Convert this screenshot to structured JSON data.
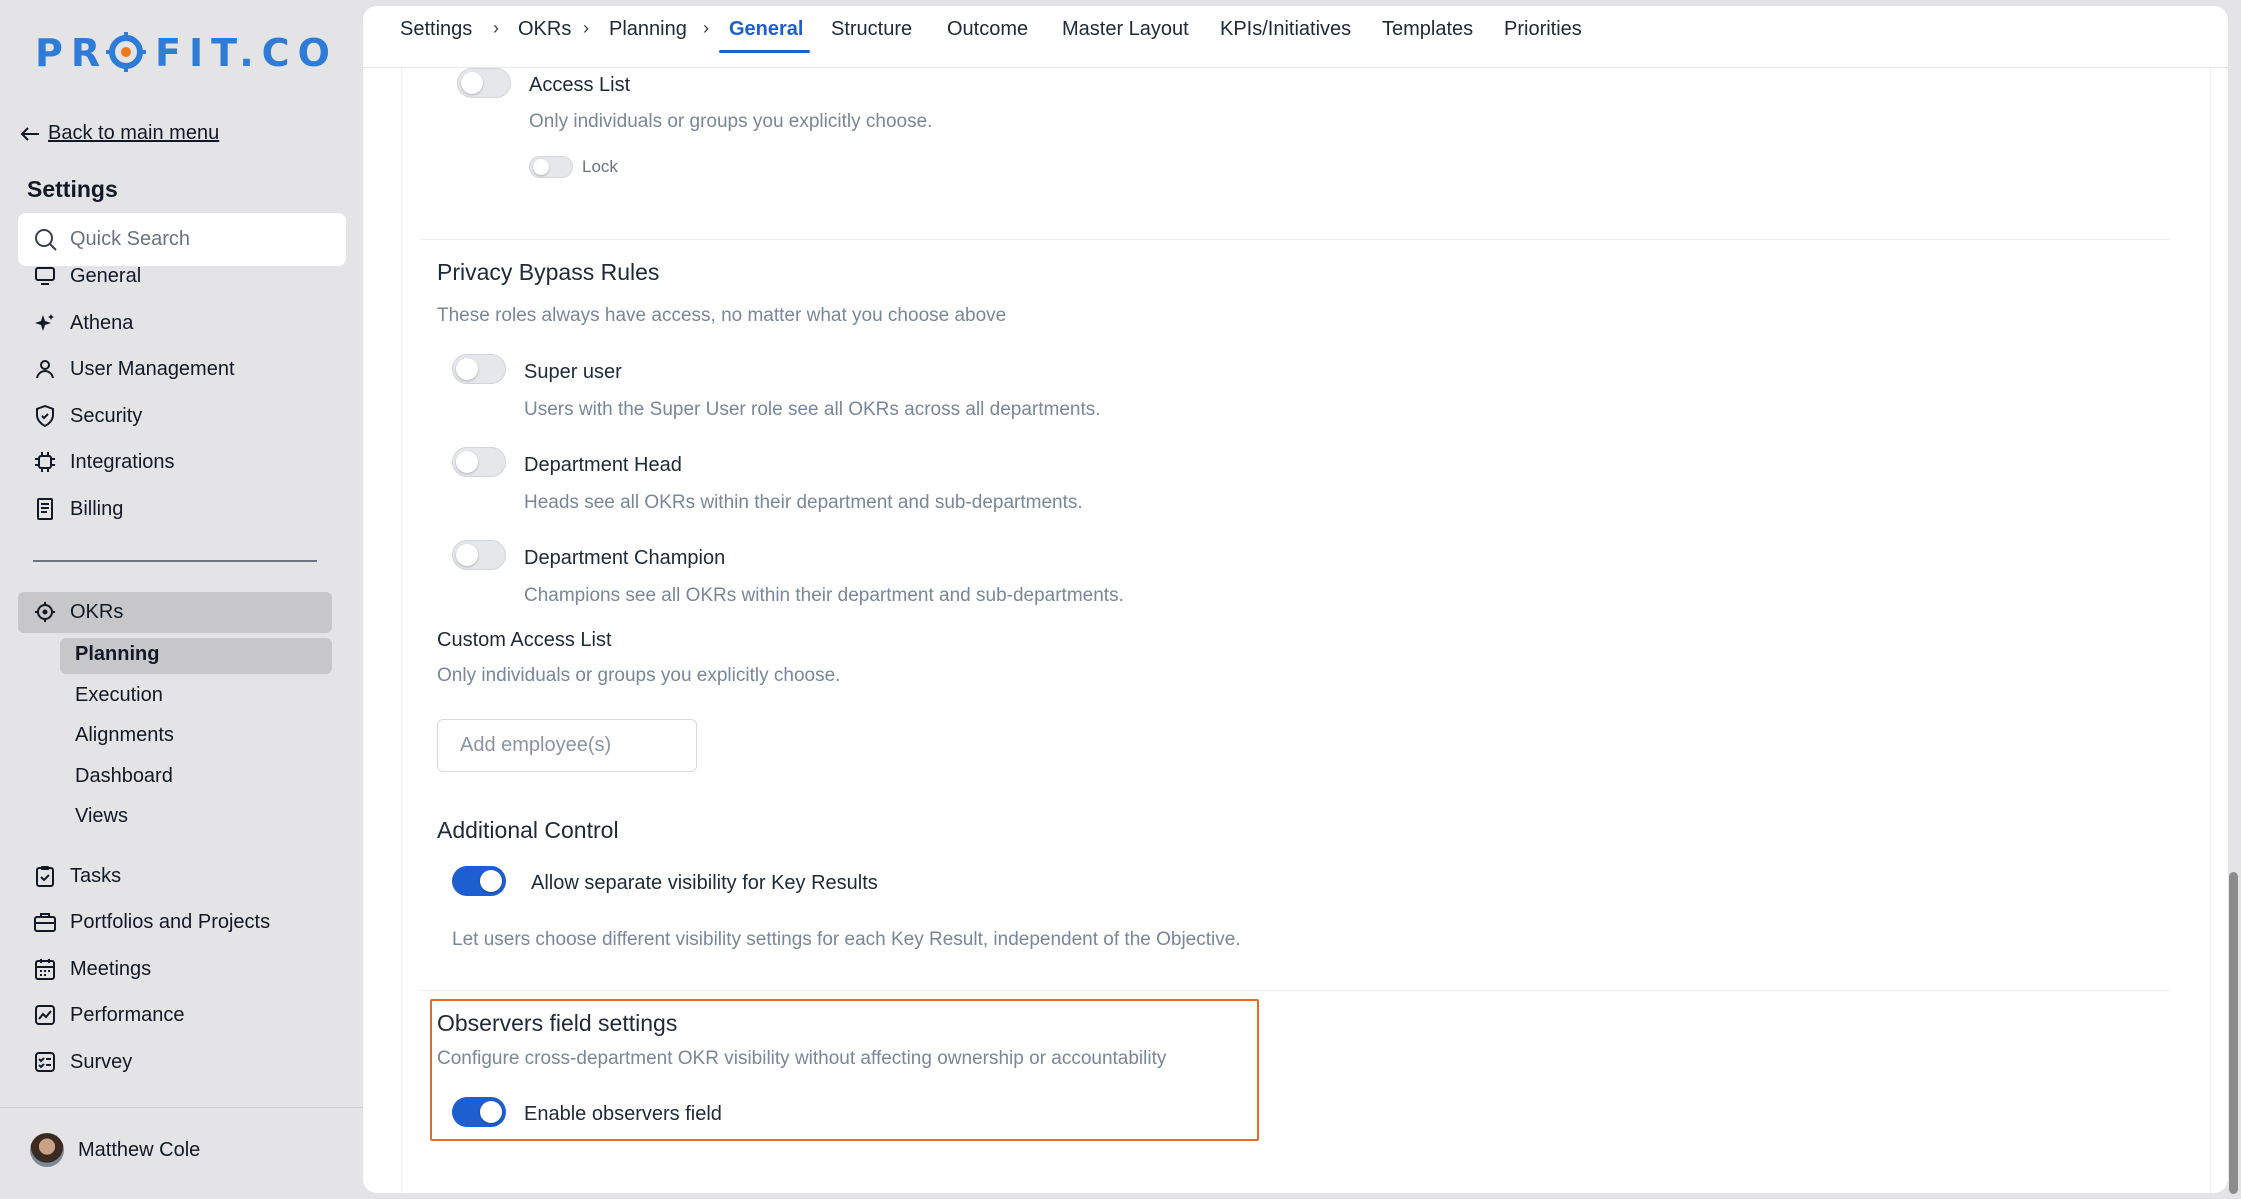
{
  "brand": {
    "logo_text": "PROFIT.CO",
    "accent": "#2e7bd8",
    "logo_dot": "#f07a1a"
  },
  "sidebar": {
    "back_link": "Back to main menu",
    "title": "Settings",
    "search_placeholder": "Quick Search",
    "items": [
      {
        "label": "General",
        "icon": "monitor-icon"
      },
      {
        "label": "Athena",
        "icon": "sparkle-icon"
      },
      {
        "label": "User Management",
        "icon": "user-icon"
      },
      {
        "label": "Security",
        "icon": "shield-icon"
      },
      {
        "label": "Integrations",
        "icon": "chip-icon"
      },
      {
        "label": "Billing",
        "icon": "receipt-icon"
      }
    ],
    "okrs": {
      "label": "OKRs",
      "icon": "target-icon",
      "children": [
        "Planning",
        "Execution",
        "Alignments",
        "Dashboard",
        "Views"
      ],
      "active_child": "Planning"
    },
    "more_items": [
      {
        "label": "Tasks",
        "icon": "clipboard-check-icon"
      },
      {
        "label": "Portfolios and Projects",
        "icon": "briefcase-icon"
      },
      {
        "label": "Meetings",
        "icon": "calendar-icon"
      },
      {
        "label": "Performance",
        "icon": "chart-line-icon"
      },
      {
        "label": "Survey",
        "icon": "checklist-icon"
      }
    ],
    "user": {
      "name": "Matthew Cole"
    }
  },
  "topnav": {
    "breadcrumb": [
      "Settings",
      "OKRs",
      "Planning"
    ],
    "separator": "›",
    "tabs": [
      "General",
      "Structure",
      "Outcome",
      "Master Layout",
      "KPIs/Initiatives",
      "Templates",
      "Priorities"
    ],
    "active_tab": "General"
  },
  "access_list": {
    "label": "Access List",
    "description": "Only individuals or groups you explicitly choose.",
    "lock_label": "Lock",
    "enabled": false,
    "lock_enabled": false
  },
  "privacy_bypass": {
    "title": "Privacy Bypass Rules",
    "description": "These roles always have access, no matter what you choose above",
    "rules": [
      {
        "label": "Super user",
        "description": "Users with the Super User role see all OKRs across all departments.",
        "enabled": false
      },
      {
        "label": "Department Head",
        "description": "Heads see all OKRs within their department and sub-departments.",
        "enabled": false
      },
      {
        "label": "Department Champion",
        "description": "Champions see all OKRs within their department and sub-departments.",
        "enabled": false
      }
    ]
  },
  "custom_access": {
    "title": "Custom Access List",
    "description": "Only individuals or groups you explicitly choose.",
    "input_placeholder": "Add employee(s)",
    "input_value": ""
  },
  "additional_control": {
    "title": "Additional Control",
    "toggle_label": "Allow separate visibility for Key Results",
    "enabled": true,
    "description": "Let users choose different visibility settings for each Key Result, independent of the Objective."
  },
  "observers": {
    "title": "Observers field settings",
    "description": "Configure cross-department OKR visibility without affecting ownership or accountability",
    "toggle_label": "Enable observers field",
    "enabled": true,
    "highlight_color": "#ea6a2a"
  },
  "colors": {
    "primary": "#1d5fd0",
    "muted_text": "#7a8699"
  }
}
